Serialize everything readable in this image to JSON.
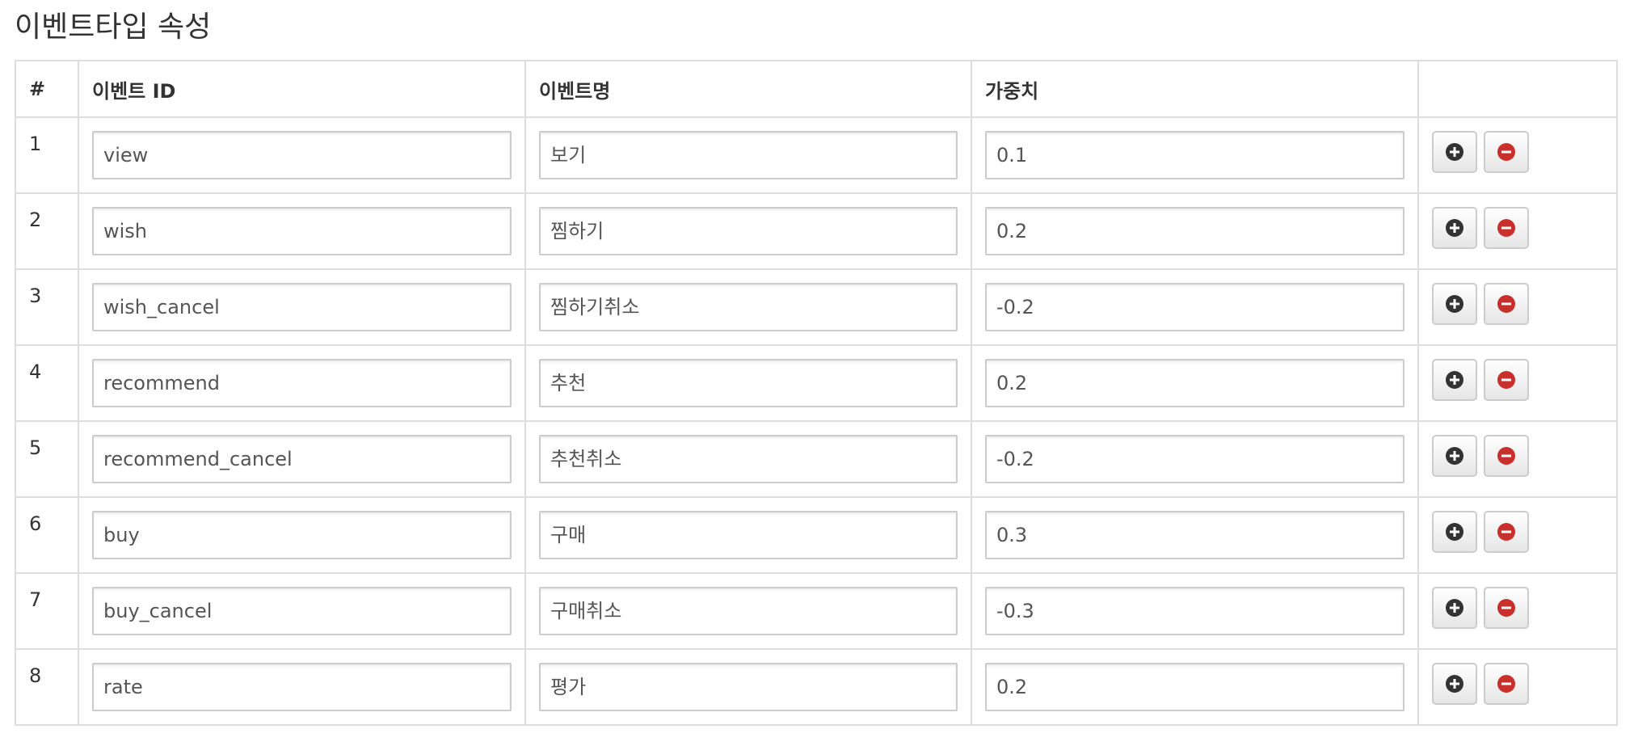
{
  "page": {
    "title": "이벤트타입 속성"
  },
  "table": {
    "headers": {
      "num": "#",
      "event_id": "이벤트 ID",
      "event_name": "이벤트명",
      "weight": "가중치",
      "actions": ""
    },
    "rows": [
      {
        "num": "1",
        "event_id": "view",
        "event_name": "보기",
        "weight": "0.1"
      },
      {
        "num": "2",
        "event_id": "wish",
        "event_name": "찜하기",
        "weight": "0.2"
      },
      {
        "num": "3",
        "event_id": "wish_cancel",
        "event_name": "찜하기취소",
        "weight": "-0.2"
      },
      {
        "num": "4",
        "event_id": "recommend",
        "event_name": "추천",
        "weight": "0.2"
      },
      {
        "num": "5",
        "event_id": "recommend_cancel",
        "event_name": "추천취소",
        "weight": "-0.2"
      },
      {
        "num": "6",
        "event_id": "buy",
        "event_name": "구매",
        "weight": "0.3"
      },
      {
        "num": "7",
        "event_id": "buy_cancel",
        "event_name": "구매취소",
        "weight": "-0.3"
      },
      {
        "num": "8",
        "event_id": "rate",
        "event_name": "평가",
        "weight": "0.2"
      }
    ]
  },
  "icons": {
    "add": "plus-circle-icon",
    "remove": "minus-circle-icon"
  },
  "colors": {
    "add_icon": "#333333",
    "remove_icon": "#c9302c",
    "border": "#dddddd"
  }
}
